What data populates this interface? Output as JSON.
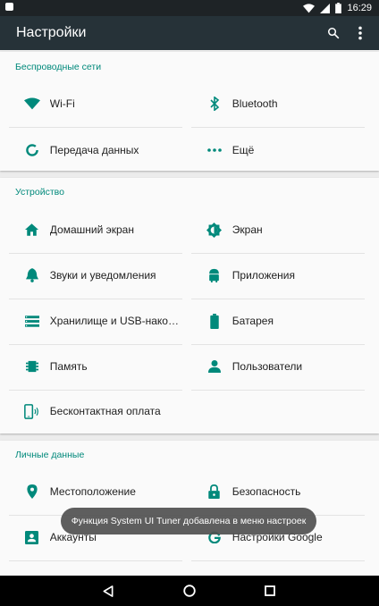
{
  "status_bar": {
    "time": "16:29"
  },
  "app_bar": {
    "title": "Настройки",
    "search_icon": "search-icon",
    "more_icon": "more-vert-icon"
  },
  "sections": {
    "wireless": {
      "title": "Беспроводные сети",
      "items": [
        {
          "label": "Wi-Fi",
          "icon": "wifi-icon"
        },
        {
          "label": "Bluetooth",
          "icon": "bluetooth-icon"
        },
        {
          "label": "Передача данных",
          "icon": "data-usage-icon"
        },
        {
          "label": "Ещё",
          "icon": "more-horiz-icon"
        }
      ]
    },
    "device": {
      "title": "Устройство",
      "items": [
        {
          "label": "Домашний экран",
          "icon": "home-icon"
        },
        {
          "label": "Экран",
          "icon": "brightness-icon"
        },
        {
          "label": "Звуки и уведомления",
          "icon": "bell-icon"
        },
        {
          "label": "Приложения",
          "icon": "android-icon"
        },
        {
          "label": "Хранилище и USB-накопит.",
          "icon": "storage-icon"
        },
        {
          "label": "Батарея",
          "icon": "battery-icon"
        },
        {
          "label": "Память",
          "icon": "memory-icon"
        },
        {
          "label": "Пользователи",
          "icon": "person-icon"
        },
        {
          "label": "Бесконтактная оплата",
          "icon": "nfc-payment-icon"
        }
      ]
    },
    "personal": {
      "title": "Личные данные",
      "items": [
        {
          "label": "Местоположение",
          "icon": "location-icon"
        },
        {
          "label": "Безопасность",
          "icon": "lock-icon"
        },
        {
          "label": "Аккаунты",
          "icon": "account-box-icon"
        },
        {
          "label": "Настройки Google",
          "icon": "google-icon"
        }
      ]
    }
  },
  "toast": {
    "text": "Функция System UI Tuner добавлена в меню настроек"
  },
  "colors": {
    "accent": "#00897b",
    "app_bar": "#263238",
    "status_bar": "#1e2326"
  }
}
